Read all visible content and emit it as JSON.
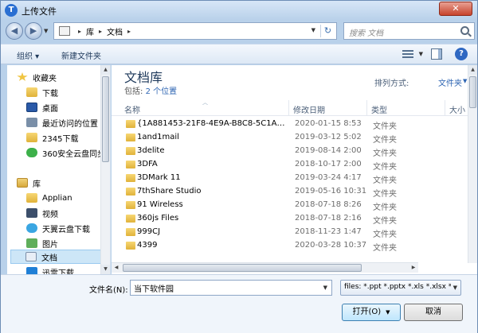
{
  "window": {
    "title": "上传文件",
    "close_label": "✕"
  },
  "address": {
    "crumbs": [
      "库",
      "文档"
    ],
    "search_placeholder": "搜索 文档"
  },
  "toolbar": {
    "organize": "组织 ▾",
    "new_folder": "新建文件夹",
    "help": "?"
  },
  "sidebar": {
    "items": [
      {
        "label": "收藏夹"
      },
      {
        "label": "下载"
      },
      {
        "label": "桌面"
      },
      {
        "label": "最近访问的位置"
      },
      {
        "label": "2345下载"
      },
      {
        "label": "360安全云盘同步"
      },
      {
        "label": "库"
      },
      {
        "label": "Applian"
      },
      {
        "label": "视频"
      },
      {
        "label": "天翼云盘下载"
      },
      {
        "label": "图片"
      },
      {
        "label": "文档"
      },
      {
        "label": "迅雷下载"
      }
    ]
  },
  "main": {
    "library_title": "文档库",
    "includes_prefix": "包括:",
    "includes_link": "2 个位置",
    "arrange_label": "排列方式:",
    "arrange_value": "文件夹",
    "columns": {
      "name": "名称",
      "date": "修改日期",
      "type": "类型",
      "size": "大小"
    },
    "files": [
      {
        "name": "{1A881453-21F8-4E9A-B8C8-5C1A19...",
        "date": "2020-01-15 8:53",
        "type": "文件夹"
      },
      {
        "name": "1and1mail",
        "date": "2019-03-12 5:02",
        "type": "文件夹"
      },
      {
        "name": "3delite",
        "date": "2019-08-14 2:00",
        "type": "文件夹"
      },
      {
        "name": "3DFA",
        "date": "2018-10-17 2:00",
        "type": "文件夹"
      },
      {
        "name": "3DMark 11",
        "date": "2019-03-24 4:17",
        "type": "文件夹"
      },
      {
        "name": "7thShare Studio",
        "date": "2019-05-16 10:31",
        "type": "文件夹"
      },
      {
        "name": "91 Wireless",
        "date": "2018-07-18 8:26",
        "type": "文件夹"
      },
      {
        "name": "360js Files",
        "date": "2018-07-18 2:16",
        "type": "文件夹"
      },
      {
        "name": "999CJ",
        "date": "2018-11-23 1:47",
        "type": "文件夹"
      },
      {
        "name": "4399",
        "date": "2020-03-28 10:37",
        "type": "文件夹"
      }
    ]
  },
  "bottom": {
    "filename_label": "文件名(N):",
    "filename_value": "当下软件园",
    "filter_text": "files: *.ppt *.pptx *.xls *.xlsx *",
    "open_label": "打开(O)",
    "cancel_label": "取消"
  }
}
